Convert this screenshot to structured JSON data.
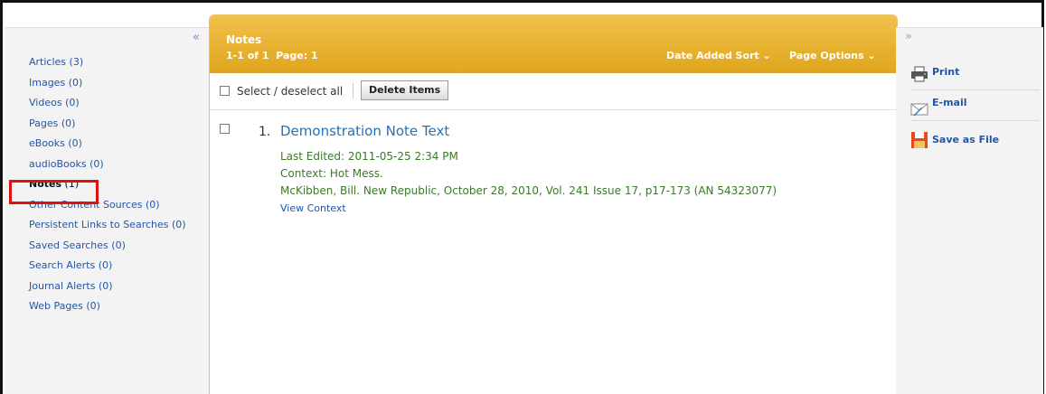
{
  "sidebar": {
    "collapse_icon": "«",
    "items": [
      {
        "label": "Articles",
        "count": "(3)"
      },
      {
        "label": "Images",
        "count": "(0)"
      },
      {
        "label": "Videos",
        "count": "(0)"
      },
      {
        "label": "Pages",
        "count": "(0)"
      },
      {
        "label": "eBooks",
        "count": "(0)"
      },
      {
        "label": "audioBooks",
        "count": "(0)"
      },
      {
        "label": "Notes",
        "count": "(1)"
      },
      {
        "label": "Other Content Sources",
        "count": "(0)"
      },
      {
        "label": "Persistent Links to Searches",
        "count": "(0)"
      },
      {
        "label": "Saved Searches",
        "count": "(0)"
      },
      {
        "label": "Search Alerts",
        "count": "(0)"
      },
      {
        "label": "Journal Alerts",
        "count": "(0)"
      },
      {
        "label": "Web Pages",
        "count": "(0)"
      }
    ]
  },
  "main": {
    "title": "Notes",
    "range": "1-1 of 1",
    "page_label": "Page: 1",
    "sort_menu": "Date Added Sort ⌄",
    "page_options_menu": "Page Options ⌄",
    "select_label": "Select / deselect all",
    "delete_button": "Delete Items",
    "note": {
      "number": "1.",
      "title": "Demonstration Note Text",
      "last_edited": "Last Edited: 2011-05-25 2:34 PM",
      "context": "Context: Hot Mess.",
      "citation": "McKibben, Bill. New Republic, October 28, 2010, Vol. 241 Issue 17, p17-173 (AN 54323077)",
      "view_context": "View Context"
    }
  },
  "rightbar": {
    "collapse_icon": "»",
    "tools": [
      {
        "label": "Print",
        "icon": "printer-icon"
      },
      {
        "label": "E-mail",
        "icon": "envelope-icon"
      },
      {
        "label": "Save as File",
        "icon": "floppy-disk-icon"
      }
    ]
  },
  "colors": {
    "header_gold": "#e7b031",
    "highlight_red": "#e01010",
    "link_blue": "#2255a5",
    "note_green": "#3a7a27"
  }
}
